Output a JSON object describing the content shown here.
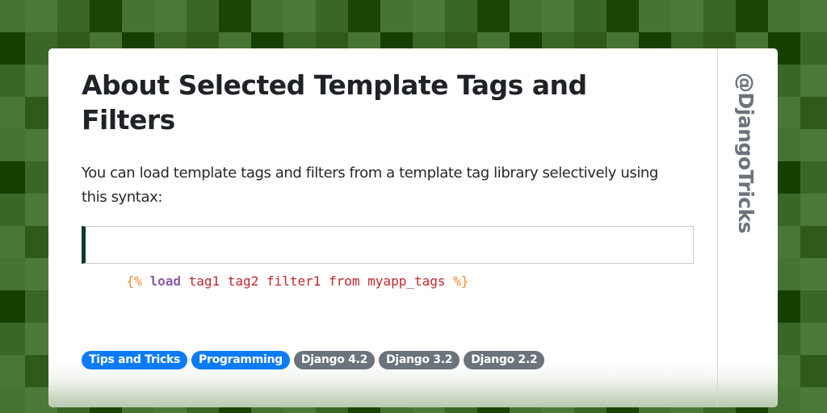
{
  "card": {
    "title": "About Selected Template Tags and Filters",
    "description": "You can load template tags and filters from a template tag library selectively using this syntax:",
    "code": {
      "tokens": [
        {
          "type": "delim",
          "text": "{%"
        },
        {
          "type": "space",
          "text": " "
        },
        {
          "type": "kw",
          "text": "load"
        },
        {
          "type": "space",
          "text": " "
        },
        {
          "type": "arg",
          "text": "tag1 tag2 filter1 from myapp_tags"
        },
        {
          "type": "space",
          "text": " "
        },
        {
          "type": "delim",
          "text": "%}"
        }
      ]
    },
    "tags": [
      {
        "label": "Tips and Tricks",
        "style": "blue"
      },
      {
        "label": "Programming",
        "style": "blue"
      },
      {
        "label": "Django 4.2",
        "style": "gray"
      },
      {
        "label": "Django 3.2",
        "style": "gray"
      },
      {
        "label": "Django 2.2",
        "style": "gray"
      }
    ],
    "handle": "@DjangoTricks"
  },
  "colors": {
    "accent_blue": "#0d7bf5",
    "tag_gray": "#6b737c",
    "code_border": "#0c3c26",
    "template_delim": "#f08a24",
    "template_keyword": "#8a5aa8",
    "template_arg": "#c0262c"
  },
  "background": {
    "pattern": "green-checker",
    "palette": [
      "#467332",
      "#4c7a39",
      "#3a6626",
      "#1a4505",
      "#163f02",
      "#2f5a1a",
      "#477433",
      "#497735"
    ]
  }
}
